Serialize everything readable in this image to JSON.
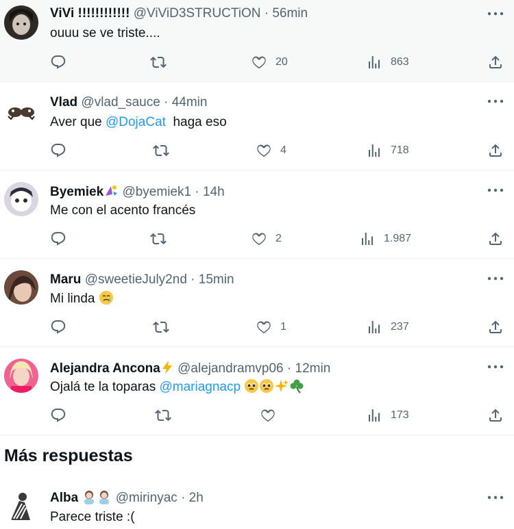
{
  "replies": [
    {
      "name": "ViVi !!!!!!!!!!!!",
      "handle": "@ViViD3STRUCTiON",
      "time": "56min",
      "text": "ouuu se ve triste....",
      "likes": "20",
      "views": "863"
    },
    {
      "name": "Vlad",
      "handle": "@vlad_sauce",
      "time": "44min",
      "text_before": "Aver que ",
      "mention": "@DojaCat",
      "text_after": "  haga eso",
      "likes": "4",
      "views": "718"
    },
    {
      "name": "Byemiek",
      "handle": "@byemiek1",
      "time": "14h",
      "text": "Me con el acento francés",
      "likes": "2",
      "views": "1.987"
    },
    {
      "name": "Maru",
      "handle": "@sweetieJuly2nd",
      "time": "15min",
      "text": "Mi linda",
      "likes": "1",
      "views": "237"
    },
    {
      "name": "Alejandra Ancona",
      "handle": "@alejandramvp06",
      "time": "12min",
      "text_before": "Ojalá te la toparas ",
      "mention": "@mariagnacp",
      "likes": "",
      "views": "173"
    }
  ],
  "more_section": {
    "title": "Más respuestas"
  },
  "more_replies": [
    {
      "name": "Alba",
      "handle": "@mirinyac",
      "time": "2h",
      "text": "Parece triste :("
    }
  ],
  "separator": "·",
  "icons": {
    "reply": "reply-icon",
    "retweet": "retweet-icon",
    "like": "heart-icon",
    "views": "views-icon",
    "share": "share-icon",
    "more": "more-icon"
  },
  "colors": {
    "text": "#0f1419",
    "secondary": "#536471",
    "link": "#1d9bf0",
    "border": "#eff3f4",
    "highlight": "#f7f9f9"
  }
}
